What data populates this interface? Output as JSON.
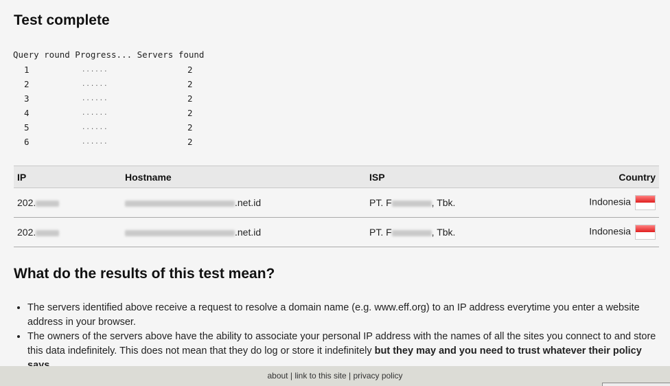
{
  "page_title": "Test complete",
  "query_table": {
    "header": "Query round Progress... Servers found",
    "rows": [
      {
        "round": "1",
        "progress": "......",
        "servers": "2"
      },
      {
        "round": "2",
        "progress": "......",
        "servers": "2"
      },
      {
        "round": "3",
        "progress": "......",
        "servers": "2"
      },
      {
        "round": "4",
        "progress": "......",
        "servers": "2"
      },
      {
        "round": "5",
        "progress": "......",
        "servers": "2"
      },
      {
        "round": "6",
        "progress": "......",
        "servers": "2"
      }
    ]
  },
  "servers_table": {
    "headers": {
      "ip": "IP",
      "hostname": "Hostname",
      "isp": "ISP",
      "country": "Country"
    },
    "rows": [
      {
        "ip_prefix": "202.",
        "hostname_suffix": ".net.id",
        "isp_prefix": "PT. F",
        "isp_suffix": ", Tbk.",
        "country": "Indonesia",
        "flag": "indonesia-flag"
      },
      {
        "ip_prefix": "202.",
        "hostname_suffix": ".net.id",
        "isp_prefix": "PT. F",
        "isp_suffix": ", Tbk.",
        "country": "Indonesia",
        "flag": "indonesia-flag"
      }
    ]
  },
  "explanation": {
    "heading": "What do the results of this test mean?",
    "bullet1": "The servers identified above receive a request to resolve a domain name (e.g. www.eff.org) to an IP address everytime you enter a website address in your browser.",
    "bullet2_text": "The owners of the servers above have the ability to associate your personal IP address with the names of all the sites you connect to and store this data indefinitely. This does not mean that they do log or store it indefinitely ",
    "bullet2_bold": "but they may and you need to trust whatever their policy says."
  },
  "footer": {
    "about": "about",
    "sep1": " | ",
    "link": "link to this site",
    "sep2": " | ",
    "privacy": "privacy policy"
  },
  "colors": {
    "background": "#f5f5f5",
    "table_header": "#e8e8e8",
    "footer": "#dcdcd6",
    "flag_red": "#e02020"
  }
}
